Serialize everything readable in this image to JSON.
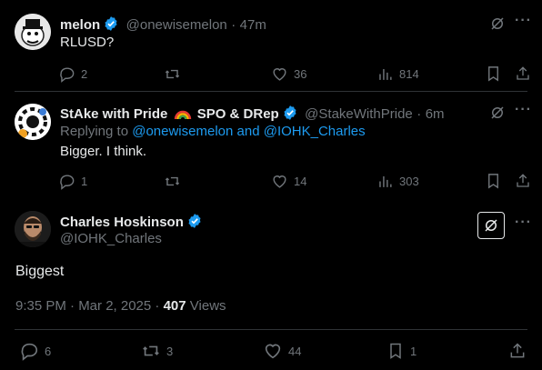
{
  "tweets": [
    {
      "display_name": "melon",
      "handle": "@onewisemelon",
      "sep": "·",
      "time": "47m",
      "text": "RLUSD?",
      "replies": "2",
      "retweets": "",
      "likes": "36",
      "views": "814"
    },
    {
      "display_name_a": "StAke with Pride",
      "display_name_b": "SPO & DRep",
      "handle": "@StakeWithPride",
      "sep": "·",
      "time": "6m",
      "replying_prefix": "Replying to",
      "replying_user1": "@onewisemelon",
      "replying_and": "and",
      "replying_user2": "@IOHK_Charles",
      "text": "Bigger. I think.",
      "replies": "1",
      "retweets": "",
      "likes": "14",
      "views": "303"
    }
  ],
  "main": {
    "display_name": "Charles Hoskinson",
    "handle": "@IOHK_Charles",
    "text": "Biggest",
    "timestamp": "9:35 PM · Mar 2, 2025",
    "dot": "·",
    "views_count": "407",
    "views_label": "Views",
    "replies": "6",
    "retweets": "3",
    "likes": "44",
    "bookmarks": "1"
  },
  "colors": {
    "accent": "#1d9bf0",
    "muted": "#71767b",
    "text": "#e7e9ea",
    "divider": "#2f3336"
  },
  "icons": [
    "verified-badge-icon",
    "reply-icon",
    "retweet-icon",
    "like-icon",
    "views-icon",
    "bookmark-icon",
    "share-icon",
    "grok-icon",
    "more-icon",
    "rainbow-emoji-icon"
  ]
}
